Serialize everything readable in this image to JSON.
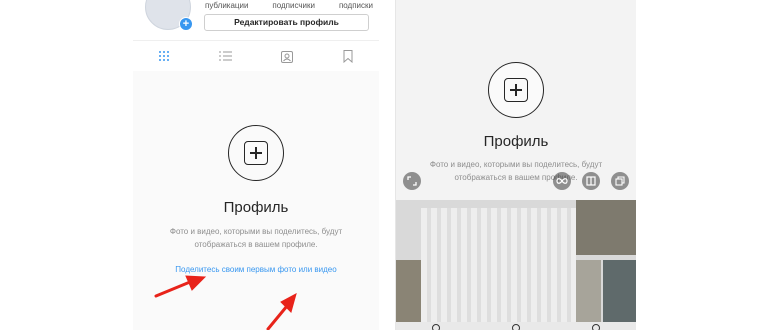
{
  "left": {
    "stats": [
      "публикации",
      "подписчики",
      "подписки"
    ],
    "edit_profile": "Редактировать профиль",
    "add_badge": "+",
    "tabs": [
      "grid-icon",
      "list-icon",
      "tagged-icon",
      "bookmark-icon"
    ],
    "title": "Профиль",
    "desc_line1": "Фото и видео, которыми вы поделитесь, будут",
    "desc_line2": "отображаться в вашем профиле.",
    "share_link": "Поделитесь своим первым фото или видео",
    "arrow_color": "#e8231a"
  },
  "right": {
    "title": "Профиль",
    "desc_line1": "Фото и видео, которыми вы поделитесь, будут",
    "desc_line2": "отображаться в вашем профиле.",
    "overlay_buttons": [
      "expand-icon",
      "infinity-icon",
      "layout-icon",
      "multiselect-icon"
    ]
  },
  "colors": {
    "accent": "#3897f0",
    "text": "#262626",
    "muted": "#8e8e8e"
  }
}
